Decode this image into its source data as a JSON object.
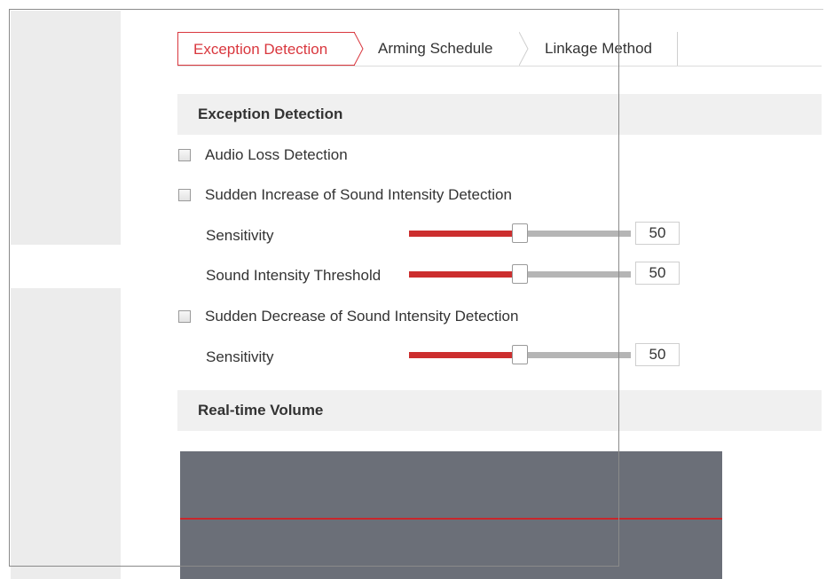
{
  "tabs": [
    {
      "label": "Exception Detection",
      "active": true
    },
    {
      "label": "Arming Schedule",
      "active": false
    },
    {
      "label": "Linkage Method",
      "active": false
    }
  ],
  "exception_detection": {
    "title": "Exception Detection",
    "audio_loss": {
      "label": "Audio Loss Detection",
      "checked": false
    },
    "sudden_increase": {
      "label": "Sudden Increase of Sound Intensity Detection",
      "checked": false,
      "sensitivity": {
        "label": "Sensitivity",
        "value": "50",
        "max": 100
      },
      "threshold": {
        "label": "Sound Intensity Threshold",
        "value": "50",
        "max": 100
      }
    },
    "sudden_decrease": {
      "label": "Sudden Decrease of Sound Intensity Detection",
      "checked": false,
      "sensitivity": {
        "label": "Sensitivity",
        "value": "50",
        "max": 100
      }
    }
  },
  "realtime_volume": {
    "title": "Real-time Volume",
    "threshold_line_color": "#c8262b",
    "panel_color": "#6b6f78"
  },
  "colors": {
    "accent": "#d9373e",
    "slider_fill": "#cc2e2e",
    "slider_track": "#b5b5b5",
    "section_bg": "#f0f0f0"
  }
}
